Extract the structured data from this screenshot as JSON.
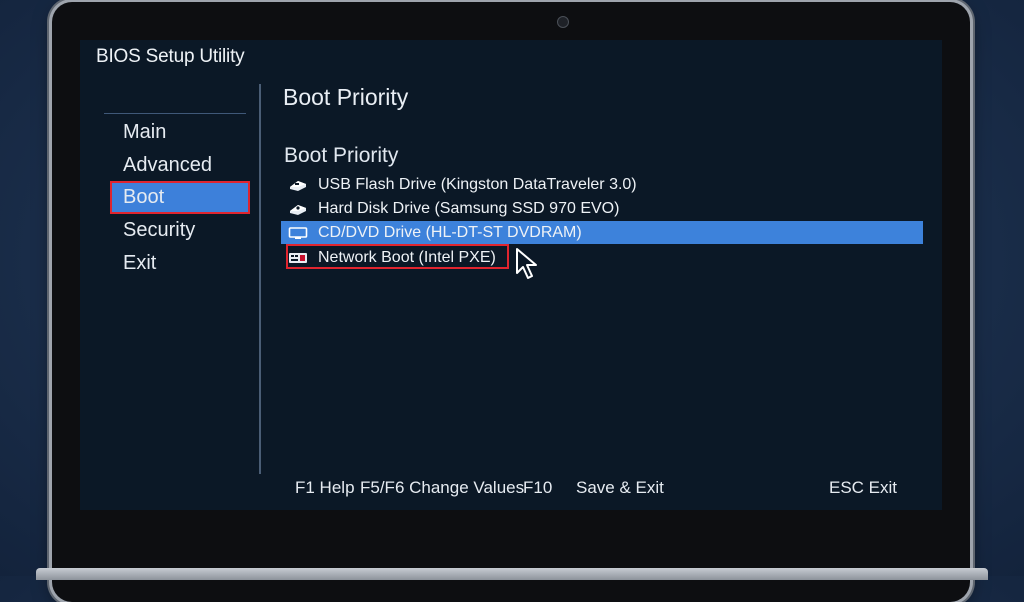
{
  "app": {
    "title": "BIOS Setup Utility"
  },
  "sidebar": {
    "items": [
      {
        "label": "Main",
        "active": false
      },
      {
        "label": "Advanced",
        "active": false
      },
      {
        "label": "Boot",
        "active": true
      },
      {
        "label": "Security",
        "active": false
      },
      {
        "label": "Exit",
        "active": false
      }
    ]
  },
  "main": {
    "page_title": "Boot Priority",
    "section_title": "Boot Priority",
    "boot_devices": [
      {
        "label": "USB Flash Drive (Kingston DataTraveler 3.0)",
        "icon": "usb-drive-icon",
        "state": "normal"
      },
      {
        "label": "Hard Disk Drive (Samsung SSD 970 EVO)",
        "icon": "hard-disk-icon",
        "state": "normal"
      },
      {
        "label": "CD/DVD Drive (HL-DT-ST DVDRAM)",
        "icon": "optical-drive-icon",
        "state": "selected"
      },
      {
        "label": "Network Boot (Intel PXE)",
        "icon": "network-card-icon",
        "state": "highlighted"
      }
    ]
  },
  "footer": {
    "help": "F1 Help",
    "change_values": "F5/F6 Change Values",
    "save_key": "F10",
    "save_exit": "Save & Exit",
    "esc_exit": "ESC Exit"
  },
  "colors": {
    "screen_bg": "#0b1826",
    "selection_blue": "#3d80da",
    "highlight_red": "#e0252f"
  }
}
